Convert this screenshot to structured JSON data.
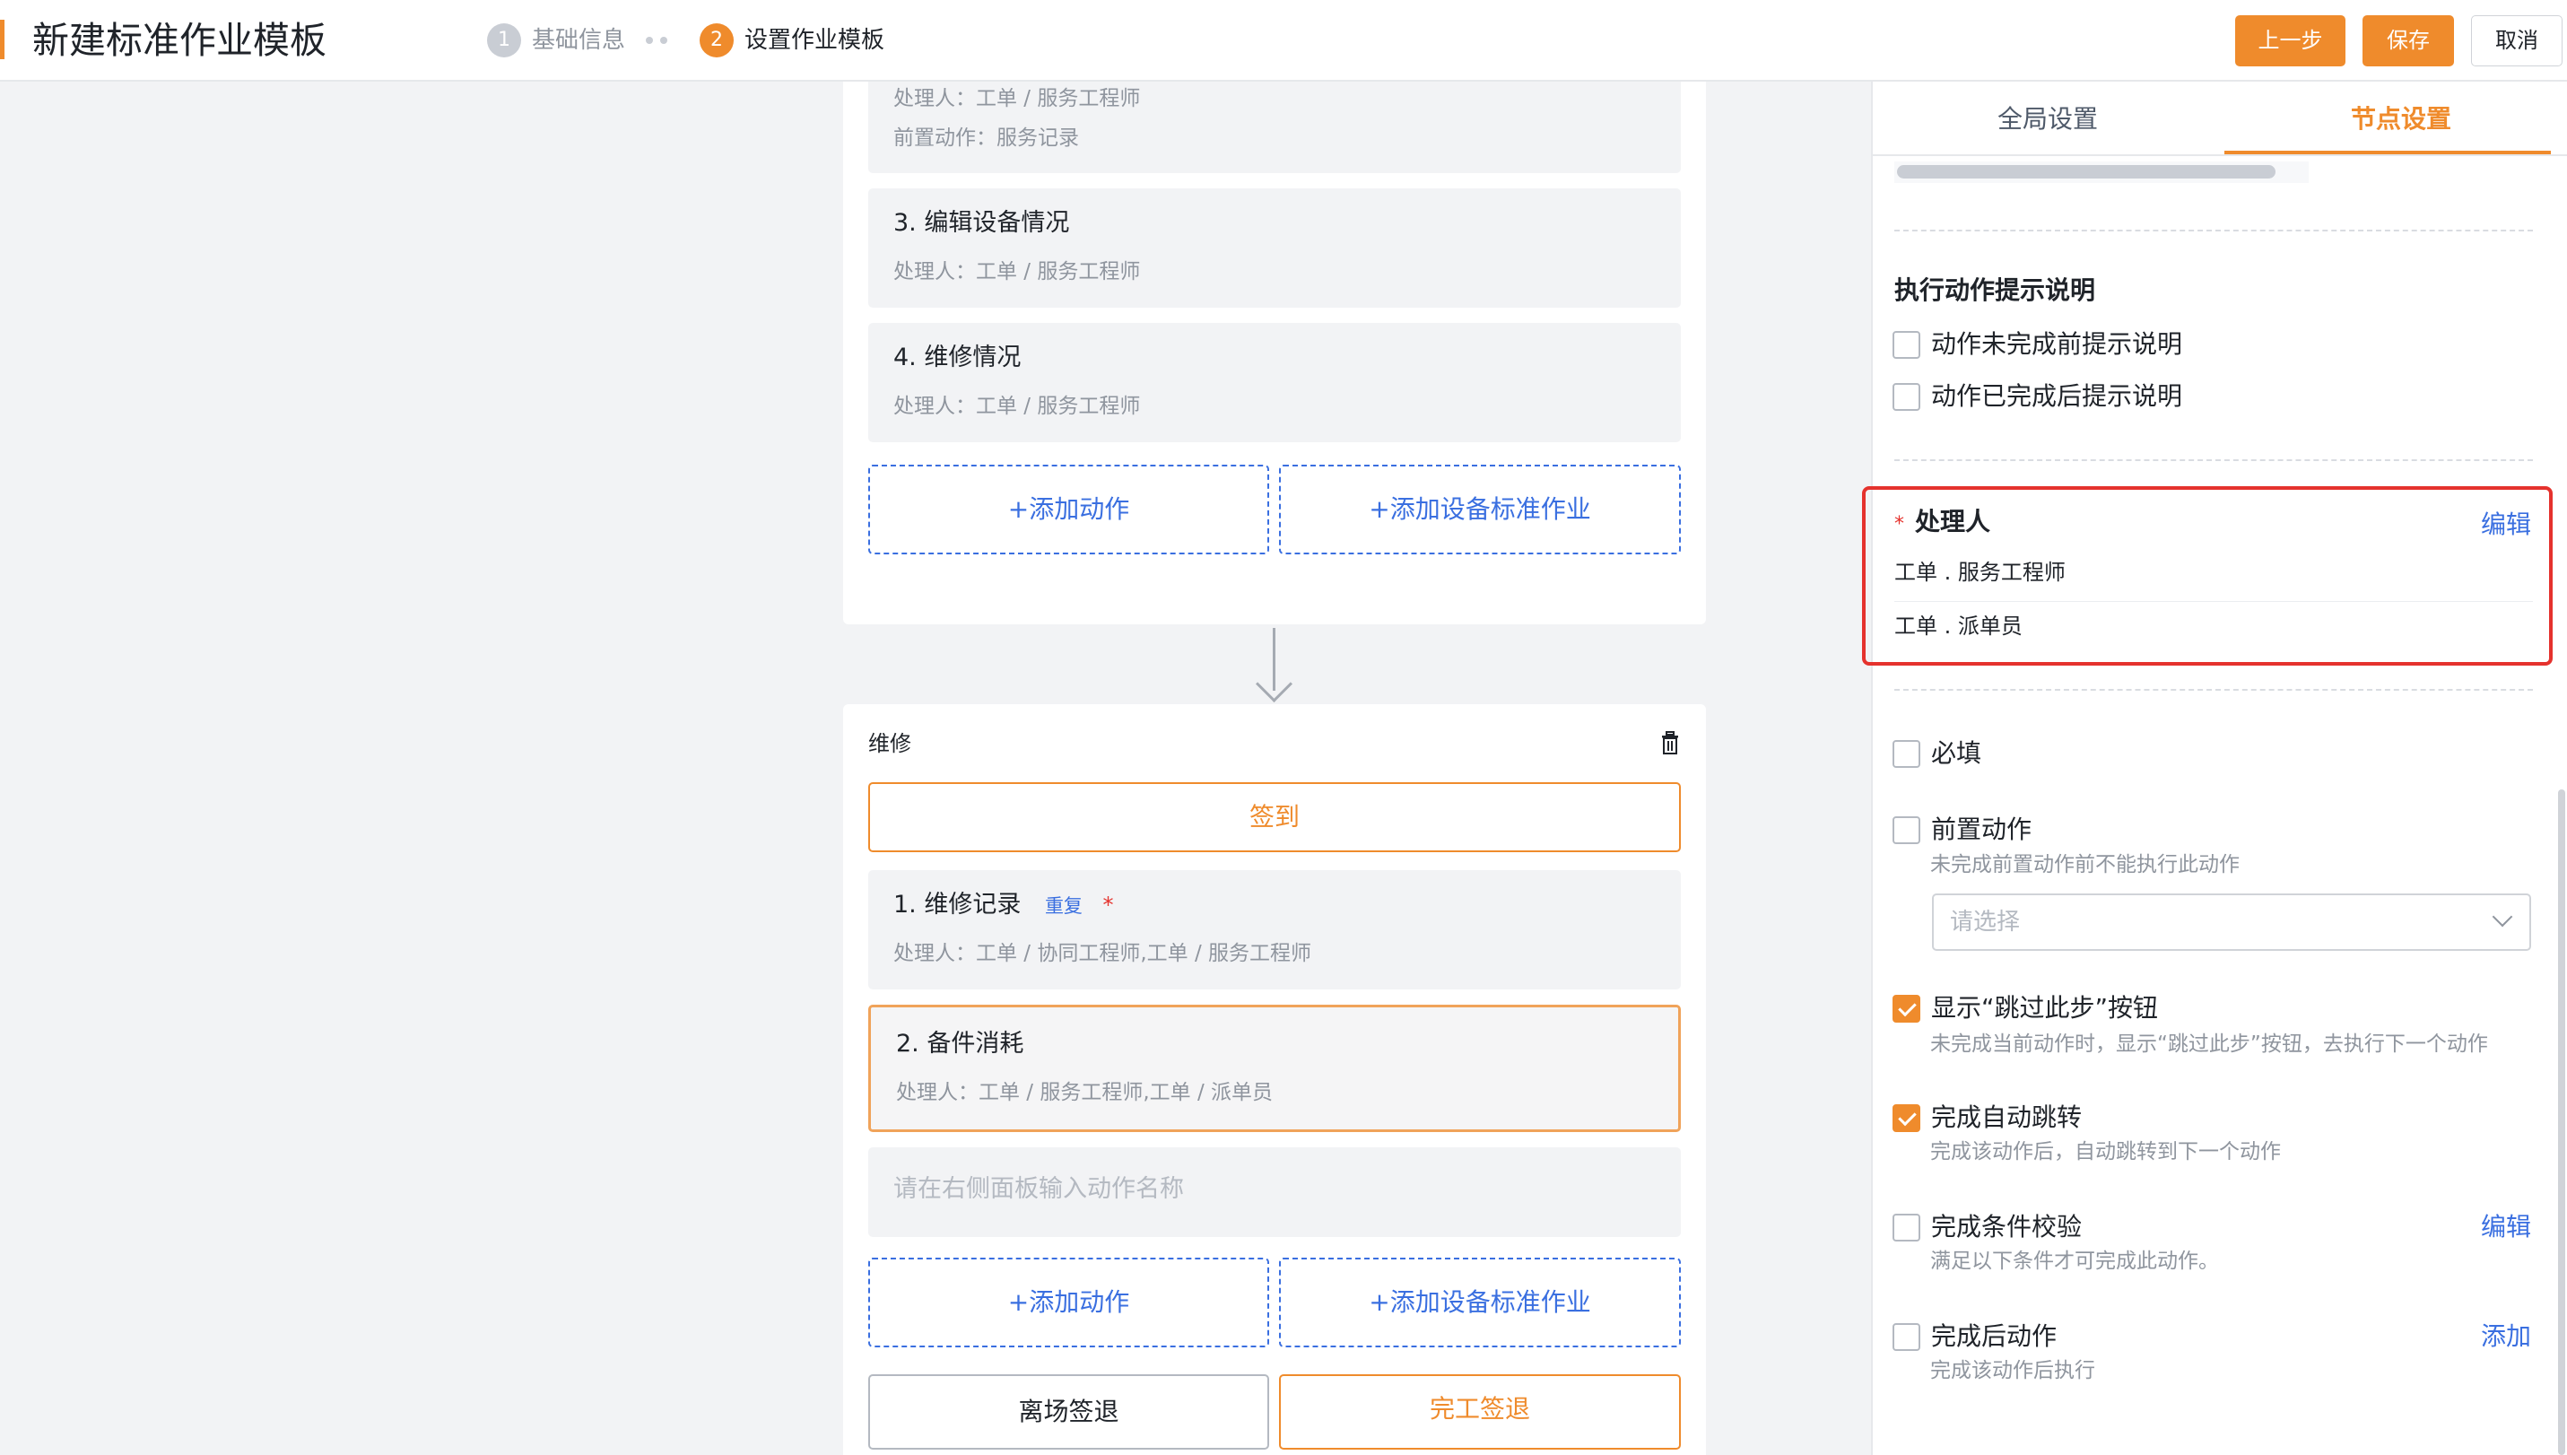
{
  "header": {
    "title": "新建标准作业模板",
    "steps": [
      {
        "num": "1",
        "label": "基础信息"
      },
      {
        "num": "2",
        "label": "设置作业模板"
      }
    ],
    "buttons": {
      "prev": "上一步",
      "save": "保存",
      "cancel": "取消"
    }
  },
  "colors": {
    "accent": "#ef8b2c",
    "link": "#3a6fe0",
    "highlight": "#e5322d"
  },
  "flow_top": {
    "partial_item": {
      "handler": "处理人：工单 / 服务工程师",
      "pre_action": "前置动作：服务记录"
    },
    "items": [
      {
        "title": "3. 编辑设备情况",
        "handler": "处理人：工单 / 服务工程师"
      },
      {
        "title": "4. 维修情况",
        "handler": "处理人：工单 / 服务工程师"
      }
    ],
    "add_action": "+添加动作",
    "add_device_standard": "+添加设备标准作业"
  },
  "flow_bottom": {
    "node_name": "维修",
    "delete_icon": "trash-icon",
    "sign_in": "签到",
    "items": [
      {
        "title": "1. 维修记录",
        "repeat_tag": "重复",
        "required_mark": "*",
        "handler": "处理人：工单 / 协同工程师,工单 / 服务工程师"
      },
      {
        "title": "2. 备件消耗",
        "handler": "处理人：工单 / 服务工程师,工单 / 派单员"
      }
    ],
    "new_action_placeholder": "请在右侧面板输入动作名称",
    "add_action": "+添加动作",
    "add_device_standard": "+添加设备标准作业",
    "leave_sign_out": "离场签退",
    "complete_sign_out": "完工签退"
  },
  "panel": {
    "tabs": {
      "global": "全局设置",
      "node": "节点设置"
    },
    "active_tab": "node",
    "exec_hint": {
      "title": "执行动作提示说明",
      "before": "动作未完成前提示说明",
      "after": "动作已完成后提示说明"
    },
    "handler": {
      "required_mark": "*",
      "title": "处理人",
      "edit": "编辑",
      "items": [
        "工单 . 服务工程师",
        "工单 . 派单员"
      ]
    },
    "required": {
      "label": "必填",
      "checked": false
    },
    "pre_action": {
      "label": "前置动作",
      "desc": "未完成前置动作前不能执行此动作",
      "placeholder": "请选择",
      "checked": false
    },
    "show_skip": {
      "label": "显示“跳过此步”按钮",
      "desc": "未完成当前动作时，显示“跳过此步”按钮，去执行下一个动作",
      "checked": true
    },
    "auto_jump": {
      "label": "完成自动跳转",
      "desc": "完成该动作后，自动跳转到下一个动作",
      "checked": true
    },
    "condition_check": {
      "label": "完成条件校验",
      "desc": "满足以下条件才可完成此动作。",
      "edit": "编辑",
      "checked": false
    },
    "post_action": {
      "label": "完成后动作",
      "desc": "完成该动作后执行",
      "add": "添加",
      "checked": false
    }
  }
}
